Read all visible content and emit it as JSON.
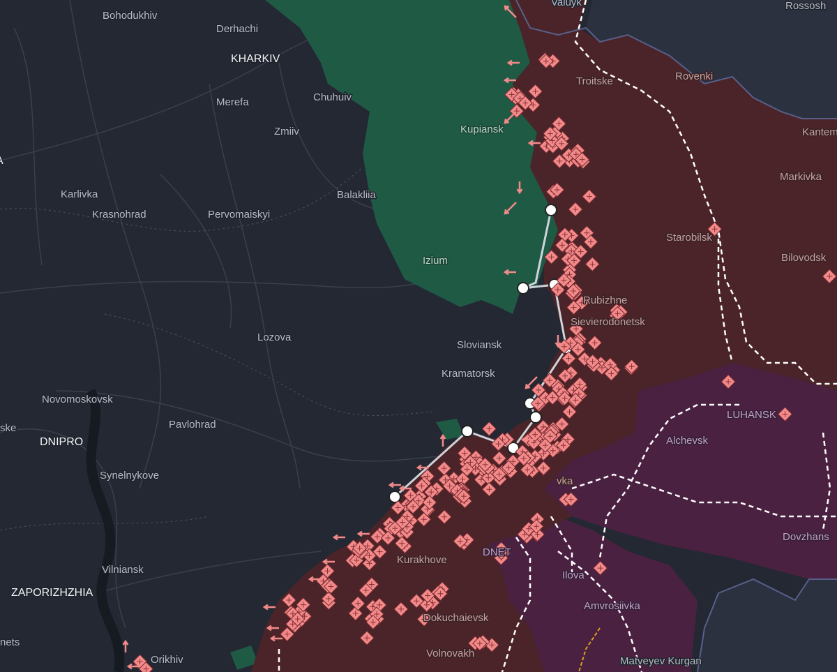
{
  "map": {
    "colors": {
      "background": "#242833",
      "liberated": "#1f5a45",
      "occupied": "#4a2428",
      "occupied_pre2022": "#4b2141",
      "event_marker": "#f08080",
      "rail_line": "#ffffff"
    },
    "labels": [
      {
        "id": "bohodukhiv",
        "text": "Bohodukhiv",
        "kind": "town"
      },
      {
        "id": "derhachi",
        "text": "Derhachi",
        "kind": "town"
      },
      {
        "id": "kharkiv",
        "text": "KHARKIV",
        "kind": "city"
      },
      {
        "id": "chuhuiv",
        "text": "Chuhuiv",
        "kind": "town"
      },
      {
        "id": "merefa",
        "text": "Merefa",
        "kind": "town"
      },
      {
        "id": "zmiiv",
        "text": "Zmiiv",
        "kind": "town"
      },
      {
        "id": "kupiansk",
        "text": "Kupiansk",
        "kind": "free"
      },
      {
        "id": "valuyki",
        "text": "Valuyk",
        "kind": "town"
      },
      {
        "id": "rossosh",
        "text": "Rossosh",
        "kind": "town"
      },
      {
        "id": "troitske",
        "text": "Troitske",
        "kind": "occ"
      },
      {
        "id": "rovenki",
        "text": "Rovenki",
        "kind": "occ"
      },
      {
        "id": "kantem",
        "text": "Kantem",
        "kind": "occ"
      },
      {
        "id": "markivka",
        "text": "Markivka",
        "kind": "occ"
      },
      {
        "id": "karlivka",
        "text": "Karlivka",
        "kind": "town"
      },
      {
        "id": "krasnohrad",
        "text": "Krasnohrad",
        "kind": "town"
      },
      {
        "id": "pervomaiskyi",
        "text": "Pervomaiskyi",
        "kind": "town"
      },
      {
        "id": "balakliia",
        "text": "Balakliia",
        "kind": "town"
      },
      {
        "id": "starobilsk",
        "text": "Starobilsk",
        "kind": "occ"
      },
      {
        "id": "bilovodsk",
        "text": "Bilovodsk",
        "kind": "occ"
      },
      {
        "id": "izium",
        "text": "Izium",
        "kind": "free"
      },
      {
        "id": "rubizhne",
        "text": "Rubizhne",
        "kind": "occ"
      },
      {
        "id": "sievierodonetsk",
        "text": "Sievierodonetsk",
        "kind": "occ"
      },
      {
        "id": "lozova",
        "text": "Lozova",
        "kind": "town"
      },
      {
        "id": "sloviansk",
        "text": "Sloviansk",
        "kind": "town"
      },
      {
        "id": "kramatorsk",
        "text": "Kramatorsk",
        "kind": "town"
      },
      {
        "id": "novomoskovsk",
        "text": "Novomoskovsk",
        "kind": "town"
      },
      {
        "id": "pavlohrad",
        "text": "Pavlohrad",
        "kind": "town"
      },
      {
        "id": "dnipro",
        "text": "DNIPRO",
        "kind": "city"
      },
      {
        "id": "ske",
        "text": "ske",
        "kind": "town"
      },
      {
        "id": "luhansk",
        "text": "LUHANSK",
        "kind": "occ2"
      },
      {
        "id": "alchevsk",
        "text": "Alchevsk",
        "kind": "occ2"
      },
      {
        "id": "synelnykove",
        "text": "Synelnykove",
        "kind": "town"
      },
      {
        "id": "vka",
        "text": "vka",
        "kind": "occ"
      },
      {
        "id": "kurakhove",
        "text": "Kurakhove",
        "kind": "occ"
      },
      {
        "id": "donetsk",
        "text": "DNET",
        "kind": "occ2"
      },
      {
        "id": "dovzhansk",
        "text": "Dovzhans",
        "kind": "occ2"
      },
      {
        "id": "vilniansk",
        "text": "Vilniansk",
        "kind": "town"
      },
      {
        "id": "ilovaisk",
        "text": "Ilova",
        "kind": "occ2"
      },
      {
        "id": "zaporizhzhia",
        "text": "ZAPORIZHZHIA",
        "kind": "city"
      },
      {
        "id": "amvrosiivka",
        "text": "Amvrosiivka",
        "kind": "occ2"
      },
      {
        "id": "dokuchaievsk",
        "text": "Dokuchaievsk",
        "kind": "occ"
      },
      {
        "id": "nets",
        "text": "nets",
        "kind": "town"
      },
      {
        "id": "orikhiv",
        "text": "Orikhiv",
        "kind": "town"
      },
      {
        "id": "volnovakha",
        "text": "Volnovakh",
        "kind": "occ"
      },
      {
        "id": "matveyev_kurgan",
        "text": "Matveyev Kurgan",
        "kind": "town"
      },
      {
        "id": "a_edge",
        "text": "A",
        "kind": "city"
      }
    ]
  }
}
